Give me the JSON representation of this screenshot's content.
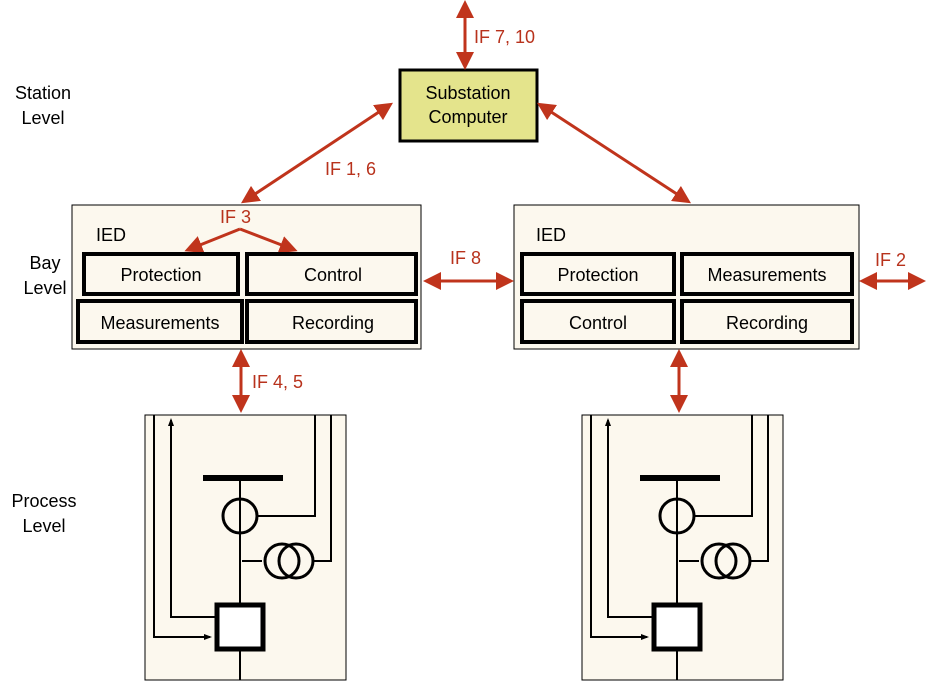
{
  "levels": {
    "station": [
      "Station",
      "Level"
    ],
    "bay": [
      "Bay",
      "Level"
    ],
    "process": [
      "Process",
      "Level"
    ]
  },
  "substation": {
    "line1": "Substation",
    "line2": "Computer"
  },
  "interfaces": {
    "if_7_10": "IF 7, 10",
    "if_1_6": "IF 1, 6",
    "if_3": "IF 3",
    "if_8": "IF 8",
    "if_2": "IF 2",
    "if_4_5": "IF 4, 5"
  },
  "left_ied": {
    "title": "IED",
    "modules": [
      "Protection",
      "Control",
      "Measurements",
      "Recording"
    ]
  },
  "right_ied": {
    "title": "IED",
    "modules": [
      "Protection",
      "Measurements",
      "Control",
      "Recording"
    ]
  },
  "colors": {
    "interface_arrow": "#c0341c",
    "substation_fill": "#e4e48c",
    "box_fill": "#fcf8ee"
  }
}
